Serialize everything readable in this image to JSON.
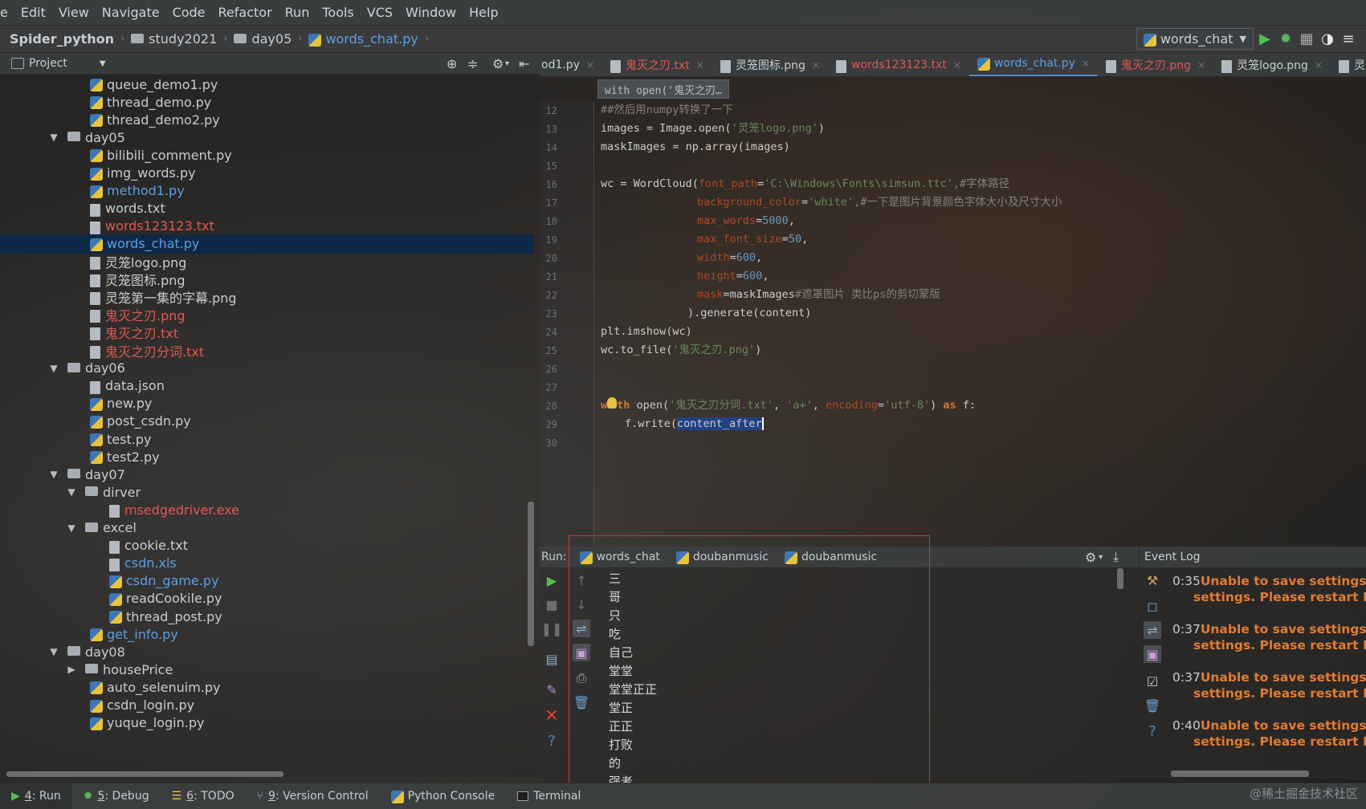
{
  "menu": [
    "e",
    "Edit",
    "View",
    "Navigate",
    "Code",
    "Refactor",
    "Run",
    "Tools",
    "VCS",
    "Window",
    "Help"
  ],
  "breadcrumb": {
    "project": "Spider_python",
    "folder1": "study2021",
    "folder2": "day05",
    "file": "words_chat.py"
  },
  "run_config": "words_chat",
  "project_panel": {
    "title": "Project"
  },
  "tree": [
    {
      "label": "queue_demo1.py",
      "type": "py",
      "indent": 1,
      "color": "normal"
    },
    {
      "label": "thread_demo.py",
      "type": "py",
      "indent": 1,
      "color": "normal"
    },
    {
      "label": "thread_demo2.py",
      "type": "py",
      "indent": 1,
      "color": "normal"
    },
    {
      "label": "day05",
      "type": "folder",
      "indent": 0,
      "color": "normal"
    },
    {
      "label": "bilibili_comment.py",
      "type": "py",
      "indent": 1,
      "color": "normal"
    },
    {
      "label": "img_words.py",
      "type": "py",
      "indent": 1,
      "color": "normal"
    },
    {
      "label": "method1.py",
      "type": "py",
      "indent": 1,
      "color": "blue"
    },
    {
      "label": "words.txt",
      "type": "file",
      "indent": 1,
      "color": "normal"
    },
    {
      "label": "words123123.txt",
      "type": "file",
      "indent": 1,
      "color": "red"
    },
    {
      "label": "words_chat.py",
      "type": "py",
      "indent": 1,
      "color": "blue",
      "selected": true
    },
    {
      "label": "灵笼logo.png",
      "type": "file",
      "indent": 1,
      "color": "normal"
    },
    {
      "label": "灵笼图标.png",
      "type": "file",
      "indent": 1,
      "color": "normal"
    },
    {
      "label": "灵笼第一集的字幕.png",
      "type": "file",
      "indent": 1,
      "color": "normal"
    },
    {
      "label": "鬼灭之刃.png",
      "type": "file",
      "indent": 1,
      "color": "red"
    },
    {
      "label": "鬼灭之刃.txt",
      "type": "file",
      "indent": 1,
      "color": "red"
    },
    {
      "label": "鬼灭之刃分词.txt",
      "type": "file",
      "indent": 1,
      "color": "red"
    },
    {
      "label": "day06",
      "type": "folder",
      "indent": 0,
      "color": "normal"
    },
    {
      "label": "data.json",
      "type": "file",
      "indent": 1,
      "color": "normal"
    },
    {
      "label": "new.py",
      "type": "py",
      "indent": 1,
      "color": "normal"
    },
    {
      "label": "post_csdn.py",
      "type": "py",
      "indent": 1,
      "color": "normal"
    },
    {
      "label": "test.py",
      "type": "py",
      "indent": 1,
      "color": "normal"
    },
    {
      "label": "test2.py",
      "type": "py",
      "indent": 1,
      "color": "normal"
    },
    {
      "label": "day07",
      "type": "folder",
      "indent": 0,
      "color": "normal"
    },
    {
      "label": "dirver",
      "type": "folder",
      "indent": 1,
      "color": "normal"
    },
    {
      "label": "msedgedriver.exe",
      "type": "file",
      "indent": 2,
      "color": "red"
    },
    {
      "label": "excel",
      "type": "folder",
      "indent": 1,
      "color": "normal"
    },
    {
      "label": "cookie.txt",
      "type": "file",
      "indent": 2,
      "color": "normal"
    },
    {
      "label": "csdn.xls",
      "type": "file",
      "indent": 2,
      "color": "blue"
    },
    {
      "label": "csdn_game.py",
      "type": "py",
      "indent": 2,
      "color": "blue"
    },
    {
      "label": "readCookile.py",
      "type": "py",
      "indent": 2,
      "color": "normal"
    },
    {
      "label": "thread_post.py",
      "type": "py",
      "indent": 2,
      "color": "normal"
    },
    {
      "label": "get_info.py",
      "type": "py",
      "indent": 1,
      "color": "blue"
    },
    {
      "label": "day08",
      "type": "folder",
      "indent": 0,
      "color": "normal"
    },
    {
      "label": "housePrice",
      "type": "folder",
      "indent": 1,
      "color": "normal",
      "collapsed": true
    },
    {
      "label": "auto_selenuim.py",
      "type": "py",
      "indent": 1,
      "color": "normal"
    },
    {
      "label": "csdn_login.py",
      "type": "py",
      "indent": 1,
      "color": "normal"
    },
    {
      "label": "yuque_login.py",
      "type": "py",
      "indent": 1,
      "color": "normal"
    }
  ],
  "editor_tabs": [
    {
      "label": "od1.py",
      "type": "py",
      "color": "normal"
    },
    {
      "label": "鬼灭之刃.txt",
      "type": "file",
      "color": "red"
    },
    {
      "label": "灵笼图标.png",
      "type": "file",
      "color": "normal"
    },
    {
      "label": "words123123.txt",
      "type": "file",
      "color": "red"
    },
    {
      "label": "words_chat.py",
      "type": "py",
      "color": "blue",
      "active": true
    },
    {
      "label": "鬼灭之刃.png",
      "type": "file",
      "color": "red"
    },
    {
      "label": "灵笼logo.png",
      "type": "file",
      "color": "normal"
    },
    {
      "label": "灵笼第",
      "type": "file",
      "color": "normal"
    }
  ],
  "sticky_header": "with open('鬼灭之刃…",
  "line_numbers": [
    "12",
    "13",
    "14",
    "15",
    "16",
    "17",
    "18",
    "19",
    "20",
    "21",
    "22",
    "23",
    "24",
    "25",
    "26",
    "27",
    "28",
    "29",
    "30"
  ],
  "code": {
    "l12": "##然后用numpy转换了一下",
    "l13a": "images = Image.open(",
    "l13b": "'灵笼logo.png'",
    "l13c": ")",
    "l14": "maskImages = np.array(images)",
    "l16a": "wc = WordCloud(",
    "l16b": "font_path",
    "l16c": "=",
    "l16d": "'C:\\Windows\\Fonts\\simsun.ttc'",
    "l16e": ",#字体路径",
    "l17a": "background_color",
    "l17b": "=",
    "l17c": "'white'",
    "l17d": ",#一下是图片背景颜色字体大小及尺寸大小",
    "l18a": "max_words",
    "l18b": "=",
    "l18c": "5000",
    "l18d": ",",
    "l19a": "max_font_size",
    "l19b": "=",
    "l19c": "50",
    "l19d": ",",
    "l20a": "width",
    "l20b": "=",
    "l20c": "600",
    "l20d": ",",
    "l21a": "height",
    "l21b": "=",
    "l21c": "600",
    "l21d": ",",
    "l22a": "mask",
    "l22b": "=maskImages",
    "l22c": "#遮罩图片 类比ps的剪切蒙版",
    "l23": ").generate(content)",
    "l24": "plt.imshow(wc)",
    "l25a": "wc.to_file(",
    "l25b": "'鬼灭之刃.png'",
    "l25c": ")",
    "l28a": "w",
    "l28b": "th",
    "l28c": " open(",
    "l28d": "'鬼灭之刃分词.txt'",
    "l28e": ", ",
    "l28f": "'a+'",
    "l28g": ", ",
    "l28h": "encoding",
    "l28i": "=",
    "l28j": "'utf-8'",
    "l28k": ") ",
    "l28l": "as",
    "l28m": " f:",
    "l29a": "f.write(",
    "l29b": "content_after"
  },
  "run_panel": {
    "label": "Run:",
    "tabs": [
      "words_chat",
      "doubanmusic",
      "doubanmusic"
    ],
    "output": [
      "三",
      "哥",
      "只",
      "吃",
      "自己",
      "堂堂",
      "堂堂正正",
      "堂正",
      "正正",
      "打败",
      "的",
      "强者"
    ]
  },
  "event_log": {
    "title": "Event Log",
    "entries": [
      {
        "time": "0:35",
        "line1": "Unable to save settings: Fail",
        "line2": "settings. Please restart PyCharm"
      },
      {
        "time": "0:37",
        "line1": "Unable to save settings: Fail",
        "line2": "settings. Please restart PyCharm"
      },
      {
        "time": "0:37",
        "line1": "Unable to save settings: Fail",
        "line2": "settings. Please restart PyCharm"
      },
      {
        "time": "0:40",
        "line1": "Unable to save settings: Fail",
        "line2": "settings. Please restart PyCharm"
      }
    ]
  },
  "statusbar": {
    "run_num": "4",
    "run": ": Run",
    "debug_num": "5",
    "debug": ": Debug",
    "todo_num": "6",
    "todo": ": TODO",
    "vc_num": "9",
    "vc": ": Version Control",
    "console": "Python Console",
    "terminal": "Terminal"
  },
  "watermark": "@稀土掘金技术社区",
  "colors": {
    "accent": "#4a88c7",
    "error": "#e0584f",
    "event_error": "#e07b35",
    "run_green": "#4fc14f",
    "highlight_box": "#d9302e"
  }
}
